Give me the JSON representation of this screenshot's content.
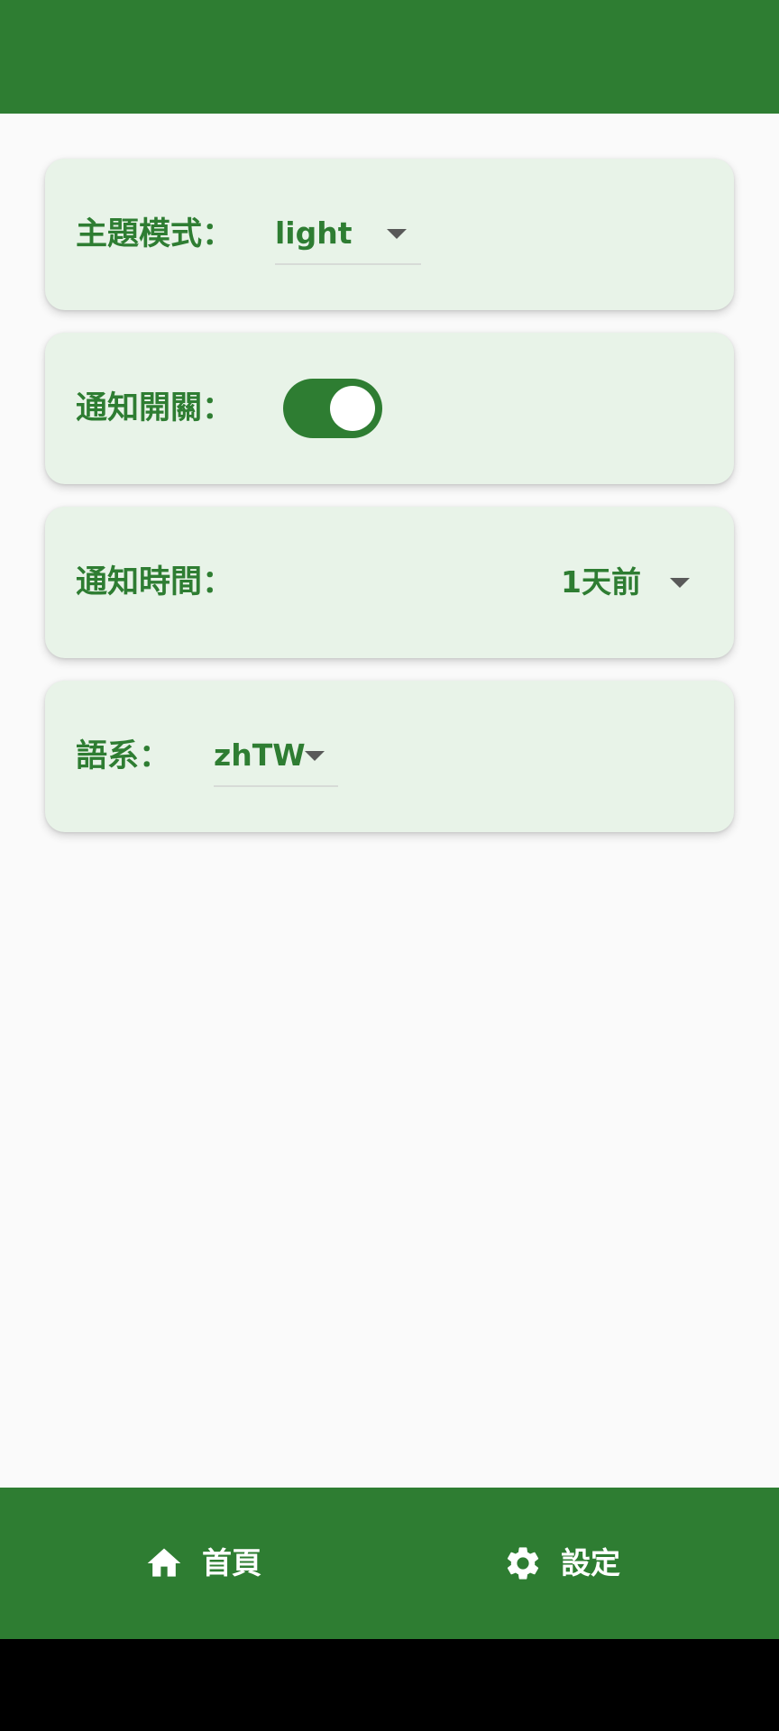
{
  "colors": {
    "primary": "#2e7d32",
    "card_background": "#e8f3e8",
    "page_background": "#fafafa",
    "caret": "#595959"
  },
  "settings": {
    "theme": {
      "label": "主題模式：",
      "value": "light"
    },
    "notification_switch": {
      "label": "通知開關：",
      "enabled": true
    },
    "notification_time": {
      "label": "通知時間：",
      "value": "1天前"
    },
    "language": {
      "label": "語系：",
      "value": "zhTW"
    }
  },
  "bottom_nav": {
    "home": {
      "label": "首頁",
      "icon": "home-icon"
    },
    "settings": {
      "label": "設定",
      "icon": "gear-icon"
    }
  }
}
